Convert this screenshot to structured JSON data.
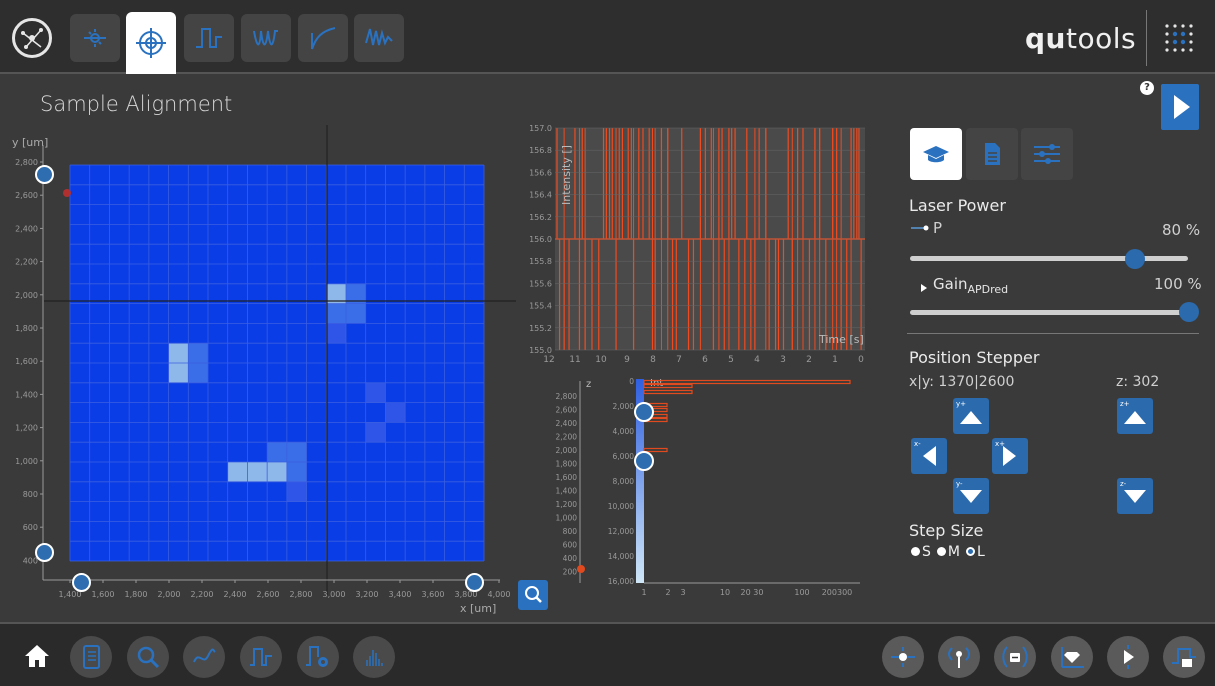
{
  "header": {
    "brand_bold": "qu",
    "brand_rest": "tools",
    "tabs": [
      "spot-icon",
      "target-icon",
      "pulse-icon",
      "wave-icon",
      "decay-icon",
      "burst-icon"
    ]
  },
  "page": {
    "title": "Sample Alignment"
  },
  "main_plot": {
    "ylabel": "y [um]",
    "xlabel": "x [um]",
    "yticks": [
      "2,800",
      "2,600",
      "2,400",
      "2,200",
      "2,000",
      "1,800",
      "1,600",
      "1,400",
      "1,200",
      "1,000",
      "800",
      "600",
      "400"
    ],
    "xticks": [
      "1,400",
      "1,600",
      "1,800",
      "2,000",
      "2,200",
      "2,400",
      "2,600",
      "2,800",
      "3,000",
      "3,200",
      "3,400",
      "3,600",
      "3,800",
      "4,000"
    ],
    "colors": {
      "background": "#0a3de6",
      "grid": "#3b5fe0",
      "bright": "#8fb8ea",
      "medium": "#3a6ee8",
      "faint": "#2f55e8"
    }
  },
  "time_chart": {
    "ylabel": "Intensity []",
    "xlabel": "Time [s]",
    "yticks": [
      "157.0",
      "156.8",
      "156.6",
      "156.4",
      "156.2",
      "156.0",
      "155.8",
      "155.6",
      "155.4",
      "155.2",
      "155.0"
    ],
    "xticks": [
      "12",
      "11",
      "10",
      "9",
      "8",
      "7",
      "6",
      "5",
      "4",
      "3",
      "2",
      "1",
      "0"
    ],
    "color": "#f04a1e"
  },
  "z_chart": {
    "zlabel": "z",
    "intlabel": "Int",
    "zticks": [
      "2,800",
      "2,600",
      "2,400",
      "2,200",
      "2,000",
      "1,800",
      "1,600",
      "1,400",
      "1,200",
      "1,000",
      "800",
      "600",
      "400",
      "200"
    ],
    "intticks": [
      "0",
      "2,000",
      "4,000",
      "6,000",
      "8,000",
      "10,000",
      "12,000",
      "14,000",
      "16,000"
    ],
    "xticks": [
      "1",
      "2",
      "3",
      "10",
      "20 30",
      "100",
      "200300"
    ]
  },
  "panel": {
    "laser_power_title": "Laser Power",
    "power_label": "P",
    "power_value": "80 %",
    "power_fraction": 0.8,
    "gain_label": "Gain",
    "gain_sub": "APDred",
    "gain_value": "100 %",
    "gain_fraction": 1.0,
    "stepper_title": "Position Stepper",
    "xy_readout": "x|y: 1370|2600",
    "z_readout": "z: 302",
    "step_labels": {
      "yplus": "y+",
      "yminus": "y-",
      "xminus": "x-",
      "xplus": "x+",
      "zplus": "z+",
      "zminus": "z-"
    },
    "step_size_title": "Step Size",
    "step_sizes": [
      "S",
      "M",
      "L"
    ],
    "step_selected": "L",
    "help": "?"
  },
  "bottom_bar": {
    "left": [
      "home-icon",
      "notebook-icon",
      "search-icon",
      "curve-icon",
      "pulse-icon",
      "settings-pulse-icon",
      "histogram-icon"
    ],
    "right": [
      "laser-icon",
      "antenna-icon",
      "minus-field-icon",
      "diamond-icon",
      "play-step-icon",
      "step-export-icon"
    ]
  }
}
